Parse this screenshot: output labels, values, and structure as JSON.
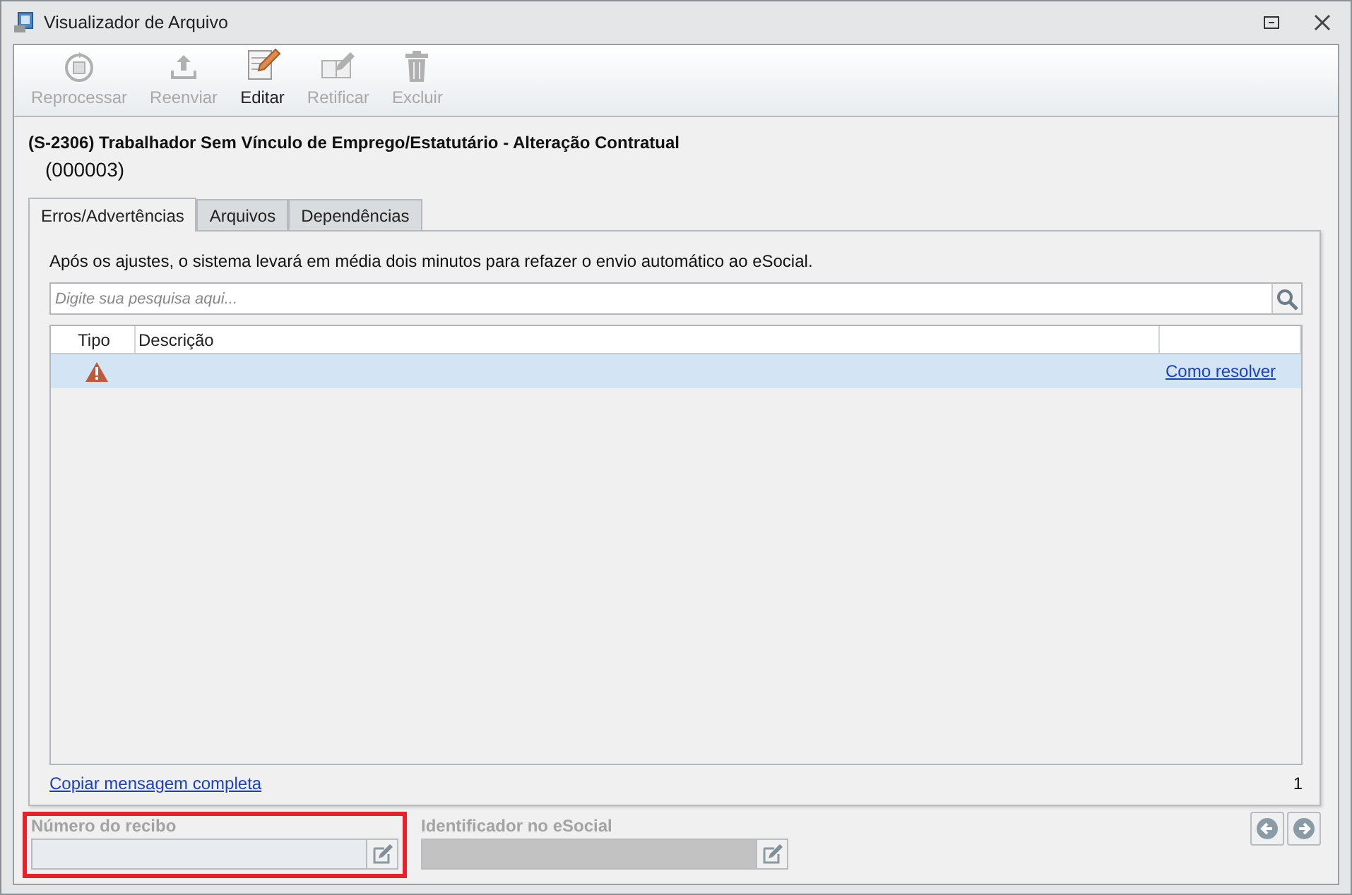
{
  "window": {
    "title": "Visualizador de Arquivo"
  },
  "toolbar": [
    {
      "label": "Reprocessar",
      "kind": "reprocess",
      "disabled": true
    },
    {
      "label": "Reenviar",
      "kind": "upload",
      "disabled": true
    },
    {
      "label": "Editar",
      "kind": "edit",
      "disabled": false
    },
    {
      "label": "Retificar",
      "kind": "rectify",
      "disabled": true
    },
    {
      "label": "Excluir",
      "kind": "delete",
      "disabled": true
    }
  ],
  "heading": {
    "title": "(S-2306) Trabalhador Sem Vínculo de Emprego/Estatutário - Alteração Contratual",
    "code": "(000003)"
  },
  "tabs": [
    {
      "label": "Erros/Advertências",
      "selected": true
    },
    {
      "label": "Arquivos",
      "selected": false
    },
    {
      "label": "Dependências",
      "selected": false
    }
  ],
  "notice": "Após os ajustes, o sistema levará em média dois minutos para refazer o envio automático ao eSocial.",
  "search": {
    "placeholder": "Digite sua pesquisa aqui..."
  },
  "table": {
    "columns": [
      "Tipo",
      "Descrição"
    ],
    "rows": [
      {
        "kind": "warning",
        "description": "",
        "link": "Como resolver",
        "selected": true
      }
    ]
  },
  "copy_link": "Copiar mensagem completa",
  "count": "1",
  "fields": [
    {
      "label": "Número do recibo",
      "highlighted": true,
      "disabled": true
    },
    {
      "label": "Identificador no eSocial",
      "highlighted": false,
      "disabled": true
    }
  ]
}
